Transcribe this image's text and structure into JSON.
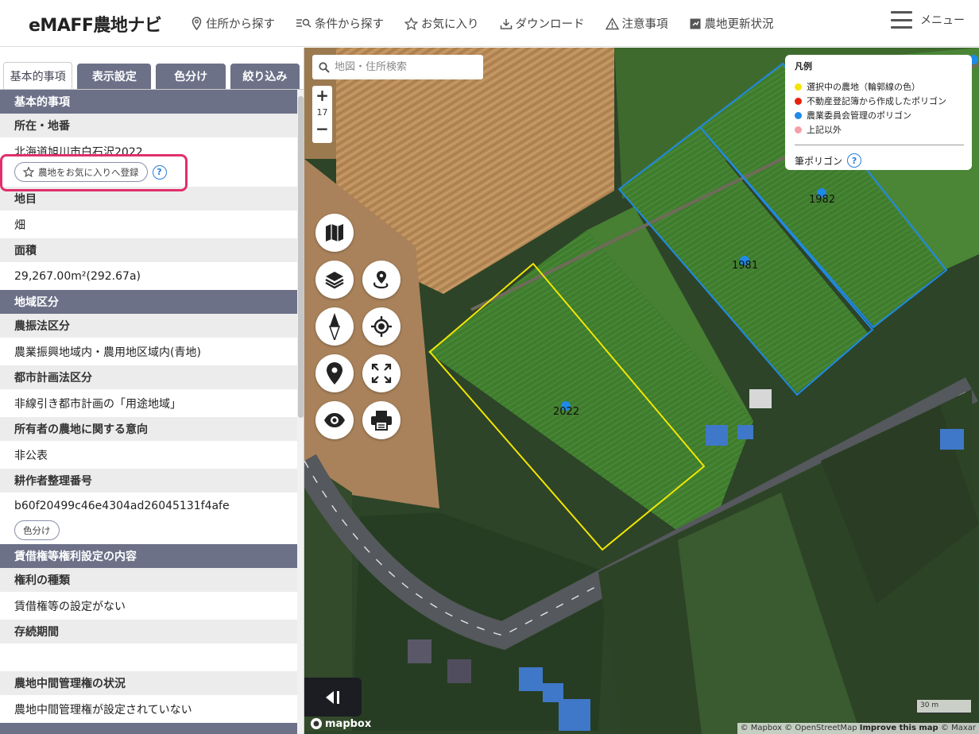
{
  "header": {
    "logo": "eMAFF農地ナビ",
    "nav": [
      {
        "label": "住所から探す",
        "icon": "map-pin-icon"
      },
      {
        "label": "条件から探す",
        "icon": "filter-search-icon"
      },
      {
        "label": "お気に入り",
        "icon": "star-icon"
      },
      {
        "label": "ダウンロード",
        "icon": "download-icon"
      },
      {
        "label": "注意事項",
        "icon": "warning-icon"
      },
      {
        "label": "農地更新状況",
        "icon": "update-icon"
      }
    ],
    "menu_label": "メニュー"
  },
  "sidebar": {
    "tabs": [
      "基本的事項",
      "表示設定",
      "色分け",
      "絞り込み"
    ],
    "active_tab": "基本的事項",
    "sections": {
      "basic_title": "基本的事項",
      "location_label": "所在・地番",
      "location_value": "北海道旭川市白石沢2022",
      "favorite_button": "農地をお気に入りへ登録",
      "land_type_label": "地目",
      "land_type_value": "畑",
      "area_label": "面積",
      "area_value": "29,267.00m²(292.67a)",
      "zoning_title": "地域区分",
      "farm_law_label": "農振法区分",
      "farm_law_value": "農業振興地域内・農用地区域内(青地)",
      "city_plan_label": "都市計画法区分",
      "city_plan_value": "非線引き都市計画の「用途地域」",
      "owner_intent_label": "所有者の農地に関する意向",
      "owner_intent_value": "非公表",
      "farmer_id_label": "耕作者整理番号",
      "farmer_id_value": "b60f20499c46e4304ad26045131f4afe",
      "color_button": "色分け",
      "lease_title": "賃借権等権利設定の内容",
      "right_type_label": "権利の種類",
      "right_type_value": "賃借権等の設定がない",
      "duration_label": "存続期間",
      "duration_value": "",
      "intermediary_label": "農地中間管理権の状況",
      "intermediary_value": "農地中間管理権が設定されていない"
    }
  },
  "map": {
    "search_placeholder": "地図・住所検索",
    "zoom_level": "17",
    "legend": {
      "title": "凡例",
      "items": [
        {
          "label": "選択中の農地（輪郭線の色）",
          "color": "#f2e600"
        },
        {
          "label": "不動産登記簿から作成したポリゴン",
          "color": "#e8210f"
        },
        {
          "label": "農業委員会管理のポリゴン",
          "color": "#1f8ae6"
        },
        {
          "label": "上記以外",
          "color": "#f4a0a8"
        }
      ],
      "pen_polygon": "筆ポリゴン"
    },
    "parcel_labels": [
      "2022",
      "1981",
      "1982"
    ],
    "scale_label": "30 m",
    "mapbox_label": "mapbox",
    "attribution": "© Mapbox © OpenStreetMap",
    "attribution_improve": "Improve this map",
    "attribution_maxar": "© Maxar"
  }
}
